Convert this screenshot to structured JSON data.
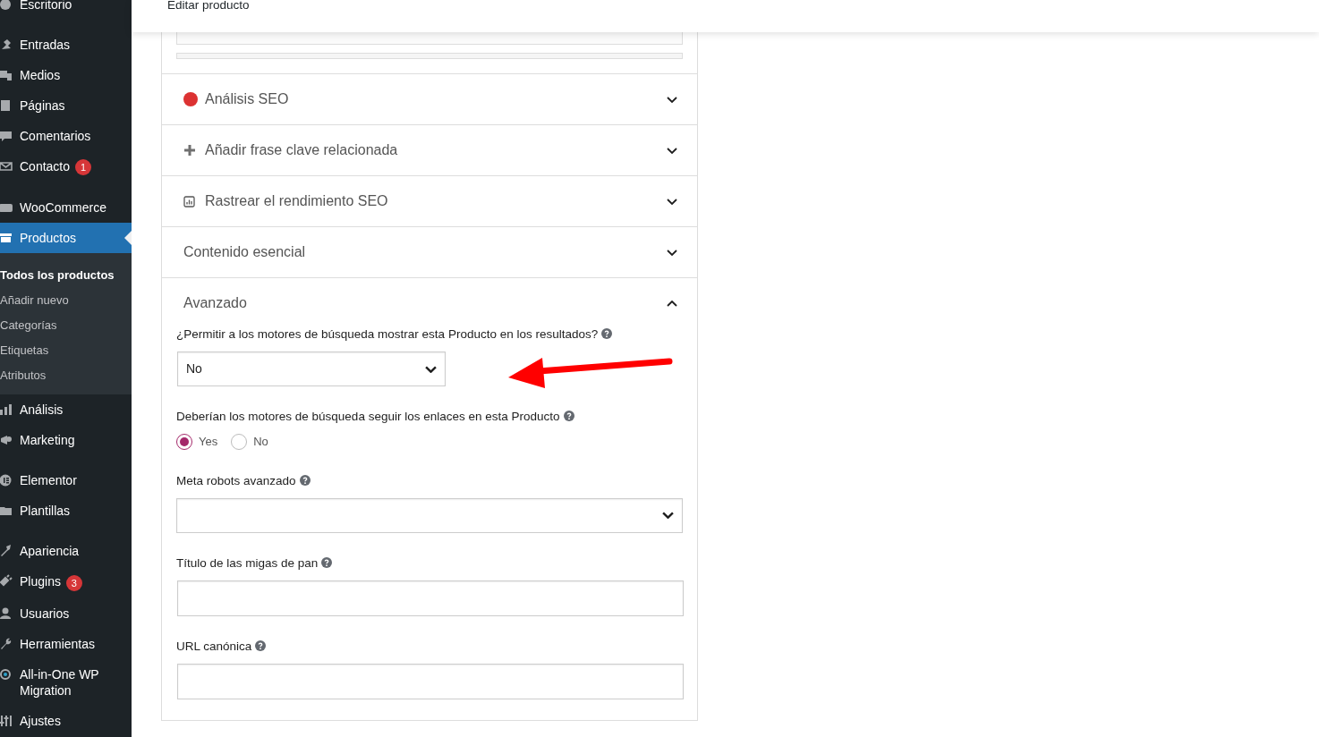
{
  "header": {
    "title": "Editar producto"
  },
  "sidebar": {
    "groups": [
      [
        {
          "label": "Escritorio",
          "selected": false
        }
      ],
      [
        {
          "label": "Entradas",
          "selected": false
        },
        {
          "label": "Medios",
          "selected": false
        },
        {
          "label": "Páginas",
          "selected": false
        },
        {
          "label": "Comentarios",
          "selected": false
        },
        {
          "label": "Contacto",
          "selected": false,
          "badge": "1"
        }
      ],
      [
        {
          "label": "WooCommerce",
          "selected": false
        },
        {
          "label": "Productos",
          "selected": true,
          "children": [
            {
              "label": "Todos los productos",
              "selected": true
            },
            {
              "label": "Añadir nuevo",
              "selected": false
            },
            {
              "label": "Categorías",
              "selected": false
            },
            {
              "label": "Etiquetas",
              "selected": false
            },
            {
              "label": "Atributos",
              "selected": false
            }
          ]
        },
        {
          "label": "Análisis",
          "selected": false
        },
        {
          "label": "Marketing",
          "selected": false
        }
      ],
      [
        {
          "label": "Elementor",
          "selected": false
        },
        {
          "label": "Plantillas",
          "selected": false
        }
      ],
      [
        {
          "label": "Apariencia",
          "selected": false
        },
        {
          "label": "Plugins",
          "selected": false,
          "badge": "3"
        },
        {
          "label": "Usuarios",
          "selected": false
        },
        {
          "label": "Herramientas",
          "selected": false
        },
        {
          "label": "All-in-One WP Migration",
          "selected": false
        },
        {
          "label": "Ajustes",
          "selected": false
        }
      ]
    ]
  },
  "sections": [
    {
      "kind": "score",
      "title": "Análisis SEO",
      "color": "#dc3232",
      "expanded": false
    },
    {
      "kind": "add",
      "title": "Añadir frase clave relacionada",
      "expanded": false
    },
    {
      "kind": "track",
      "title": "Rastrear el rendimiento SEO",
      "expanded": false
    },
    {
      "kind": "plain",
      "title": "Contenido esencial",
      "expanded": false
    },
    {
      "kind": "plain",
      "title": "Avanzado",
      "expanded": true,
      "fields": [
        {
          "kind": "select",
          "label": "¿Permitir a los motores de búsqueda mostrar esta Producto en los resultados?",
          "value": "No",
          "narrow": true
        },
        {
          "kind": "radio",
          "label": "Deberían los motores de búsqueda seguir los enlaces en esta Producto",
          "options": [
            {
              "label": "Yes",
              "selected": true
            },
            {
              "label": "No",
              "selected": false
            }
          ]
        },
        {
          "kind": "select",
          "label": "Meta robots avanzado",
          "narrow": false
        },
        {
          "kind": "text",
          "label": "Título de las migas de pan"
        },
        {
          "kind": "text",
          "label": "URL canónica"
        }
      ]
    }
  ]
}
